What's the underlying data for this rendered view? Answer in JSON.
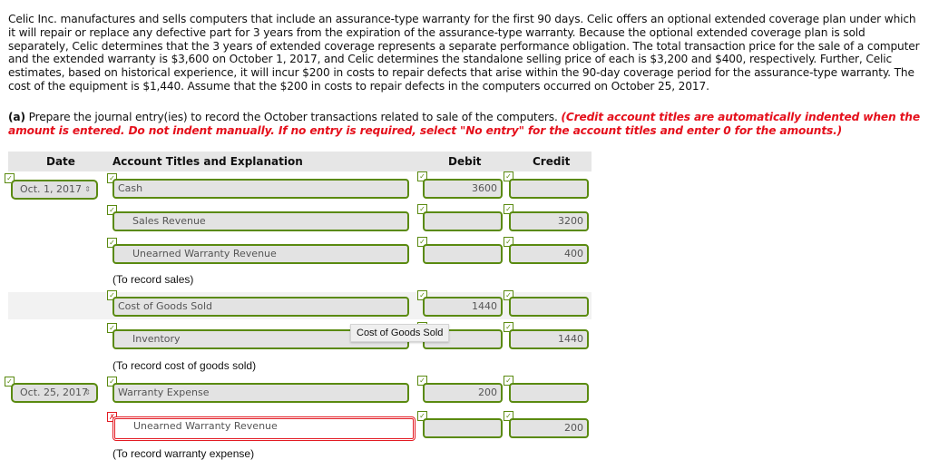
{
  "problem_text": "Celic Inc. manufactures and sells computers that include an assurance-type warranty for the first 90 days. Celic offers an optional extended coverage plan under which it will repair or replace any defective part for 3 years from the expiration of the assurance-type warranty. Because the optional extended coverage plan is sold separately, Celic determines that the 3 years of extended coverage represents a separate performance obligation. The total transaction price for the sale of a computer and the extended warranty is $3,600 on October 1, 2017, and Celic determines the standalone selling price of each is $3,200 and $400, respectively. Further, Celic estimates, based on historical experience, it will incur $200 in costs to repair defects that arise within the 90-day coverage period for the assurance-type warranty. The cost of the equipment is $1,440. Assume that the $200 in costs to repair defects in the computers occurred on October 25, 2017.",
  "part_a": {
    "label": "(a)",
    "instruction": " Prepare the journal entry(ies) to record the October transactions related to sale of the computers. ",
    "note": "(Credit account titles are automatically indented when the amount is entered. Do not indent manually. If no entry is required, select \"No entry\" for the account titles and enter 0 for the amounts.)"
  },
  "table": {
    "headers": {
      "date": "Date",
      "account": "Account Titles and Explanation",
      "debit": "Debit",
      "credit": "Credit"
    },
    "rows": [
      {
        "date": "Oct. 1, 2017",
        "account": "Cash",
        "debit": "3600",
        "credit": "",
        "status": "correct"
      },
      {
        "date": "",
        "account": "Sales Revenue",
        "debit": "",
        "credit": "3200",
        "status": "correct"
      },
      {
        "date": "",
        "account": "Unearned Warranty Revenue",
        "debit": "",
        "credit": "400",
        "status": "correct"
      },
      {
        "date": "",
        "account": "Cost of Goods Sold",
        "debit": "1440",
        "credit": "",
        "status": "correct"
      },
      {
        "date": "",
        "account": "Inventory",
        "debit": "",
        "credit": "1440",
        "status": "correct"
      },
      {
        "date": "Oct. 25, 2017",
        "account": "Warranty Expense",
        "debit": "200",
        "credit": "",
        "status": "correct"
      },
      {
        "date": "",
        "account": "Unearned Warranty Revenue",
        "debit": "",
        "credit": "200",
        "status": "incorrect"
      }
    ],
    "notes": [
      "(To record sales)",
      "(To record cost of goods sold)",
      "(To record warranty expense)"
    ]
  },
  "tooltip": "Cost of Goods Sold",
  "marks": {
    "correct": "✓",
    "incorrect": "✗"
  },
  "icons": {
    "spinner": "⇕"
  }
}
